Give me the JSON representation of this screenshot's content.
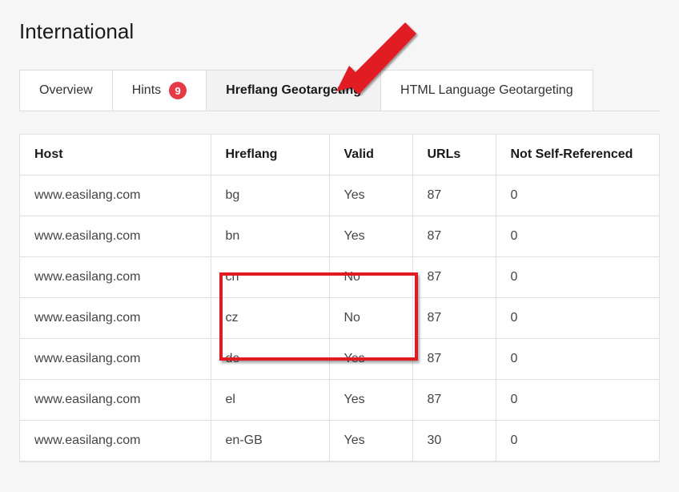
{
  "page": {
    "title": "International"
  },
  "tabs": {
    "overview": "Overview",
    "hints": "Hints",
    "hints_badge": "9",
    "hreflang_geo": "Hreflang Geotargeting",
    "html_lang_geo": "HTML Language Geotargeting"
  },
  "table": {
    "headers": {
      "host": "Host",
      "hreflang": "Hreflang",
      "valid": "Valid",
      "urls": "URLs",
      "nsr": "Not Self-Referenced"
    },
    "rows": [
      {
        "host": "www.easilang.com",
        "hreflang": "bg",
        "valid": "Yes",
        "urls": "87",
        "nsr": "0"
      },
      {
        "host": "www.easilang.com",
        "hreflang": "bn",
        "valid": "Yes",
        "urls": "87",
        "nsr": "0"
      },
      {
        "host": "www.easilang.com",
        "hreflang": "cn",
        "valid": "No",
        "urls": "87",
        "nsr": "0"
      },
      {
        "host": "www.easilang.com",
        "hreflang": "cz",
        "valid": "No",
        "urls": "87",
        "nsr": "0"
      },
      {
        "host": "www.easilang.com",
        "hreflang": "de",
        "valid": "Yes",
        "urls": "87",
        "nsr": "0"
      },
      {
        "host": "www.easilang.com",
        "hreflang": "el",
        "valid": "Yes",
        "urls": "87",
        "nsr": "0"
      },
      {
        "host": "www.easilang.com",
        "hreflang": "en-GB",
        "valid": "Yes",
        "urls": "30",
        "nsr": "0"
      }
    ]
  },
  "annotations": {
    "arrow_color": "#e11b22",
    "highlight_color": "#e11b22"
  }
}
